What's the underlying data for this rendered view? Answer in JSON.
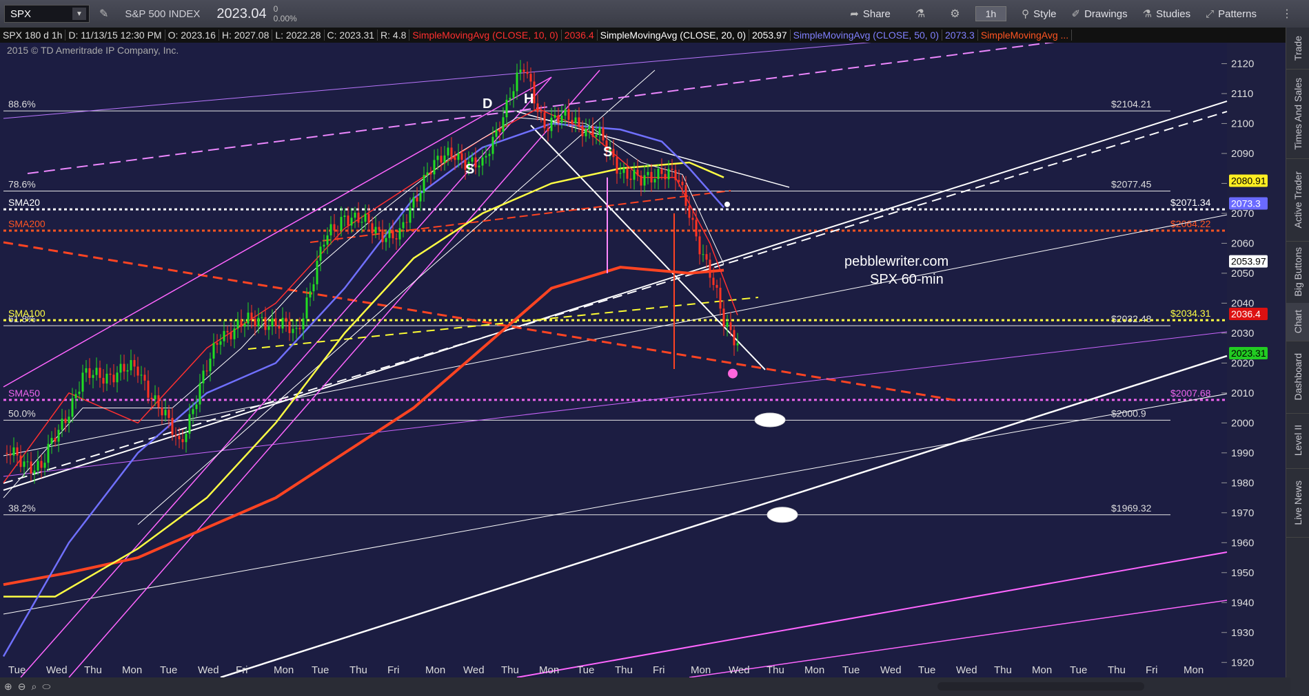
{
  "toolbar": {
    "symbol": "SPX",
    "company": "S&P 500 INDEX",
    "price": "2023.04",
    "change": "0",
    "change_pct": "0.00%",
    "share_label": "Share",
    "timeframe": "1h",
    "style_label": "Style",
    "drawings_label": "Drawings",
    "studies_label": "Studies",
    "patterns_label": "Patterns"
  },
  "infobar": {
    "desc": "SPX 180 d 1h",
    "date": "D: 11/13/15 12:30 PM",
    "open": "O: 2023.16",
    "high": "H: 2027.08",
    "low": "L: 2022.28",
    "close": "C: 2023.31",
    "range": "R: 4.8",
    "sma10": "SimpleMovingAvg (CLOSE, 10, 0)",
    "sma10_val": "2036.4",
    "sma20": "SimpleMovingAvg (CLOSE, 20, 0)",
    "sma20_val": "2053.97",
    "sma50": "SimpleMovingAvg (CLOSE, 50, 0)",
    "sma50_val": "2073.3",
    "sma_more": "SimpleMovingAvg ...",
    "colors": {
      "sma10": "#ff3030",
      "sma20": "#ffffff",
      "sma50": "#8080ff",
      "sma200": "#ff5522"
    }
  },
  "sidebar": {
    "items": [
      "Trade",
      "Times And Sales",
      "Active Trader",
      "Big Buttons",
      "Chart",
      "Dashboard",
      "Level II",
      "Live News"
    ]
  },
  "chart_data": {
    "type": "candlestick",
    "copyright": "2015 © TD Ameritrade IP Company, Inc.",
    "watermark": [
      "pebblewriter.com",
      "SPX   60-min"
    ],
    "pattern_labels": [
      "D",
      "H",
      "S",
      "S"
    ],
    "y_ticks": [
      1920,
      1930,
      1940,
      1950,
      1960,
      1970,
      1980,
      1990,
      2000,
      2010,
      2020,
      2030,
      2040,
      2050,
      2060,
      2070,
      2080,
      2090,
      2100,
      2110,
      2120
    ],
    "ylim": [
      1915,
      2127
    ],
    "x_ticks": [
      "Tue",
      "Wed",
      "Thu",
      "Mon",
      "Tue",
      "Wed",
      "Fri",
      "Mon",
      "Tue",
      "Thu",
      "Fri",
      "Mon",
      "Wed",
      "Thu",
      "Mon",
      "Tue",
      "Thu",
      "Fri",
      "Mon",
      "Wed",
      "Thu",
      "Mon",
      "Tue",
      "Wed",
      "Tue",
      "Wed",
      "Thu",
      "Mon",
      "Tue",
      "Thu",
      "Fri",
      "Mon"
    ],
    "fib_levels": [
      {
        "label": "88.6%",
        "value": 2104.21,
        "price_label": "$2104.21"
      },
      {
        "label": "78.6%",
        "value": 2077.45,
        "price_label": "$2077.45"
      },
      {
        "label": "61.8%",
        "value": 2032.48,
        "price_label": "$2032.48"
      },
      {
        "label": "50.0%",
        "value": 2000.9,
        "price_label": "$2000.9"
      },
      {
        "label": "38.2%",
        "value": 1969.32,
        "price_label": "$1969.32"
      }
    ],
    "sma_levels": [
      {
        "label": "SMA20",
        "value": 2071.34,
        "price_label": "$2071.34",
        "color": "#ffffff"
      },
      {
        "label": "SMA200",
        "value": 2064.22,
        "price_label": "$2064.22",
        "color": "#ff5522"
      },
      {
        "label": "SMA100",
        "value": 2034.31,
        "price_label": "$2034.31",
        "color": "#ffff44"
      },
      {
        "label": "SMA50",
        "value": 2007.68,
        "price_label": "$2007.68",
        "color": "#ee66ee"
      }
    ],
    "price_tags": [
      {
        "value": 2080.91,
        "label": "2080.91",
        "bg": "#ffee22",
        "fg": "#000"
      },
      {
        "value": 2073.3,
        "label": "2073.3",
        "bg": "#6a6aff",
        "fg": "#fff"
      },
      {
        "value": 2053.97,
        "label": "2053.97",
        "bg": "#ffffff",
        "fg": "#000"
      },
      {
        "value": 2036.4,
        "label": "2036.4",
        "bg": "#dd1111",
        "fg": "#fff"
      },
      {
        "value": 2023.31,
        "label": "2023.31",
        "bg": "#22cc22",
        "fg": "#000"
      }
    ],
    "targets": [
      2001.0,
      1969.32,
      2016.5
    ],
    "sma_period_labels": {
      "sma10": "10",
      "sma20": "20",
      "sma50": "50",
      "sma100": "100",
      "sma200": "200"
    }
  }
}
